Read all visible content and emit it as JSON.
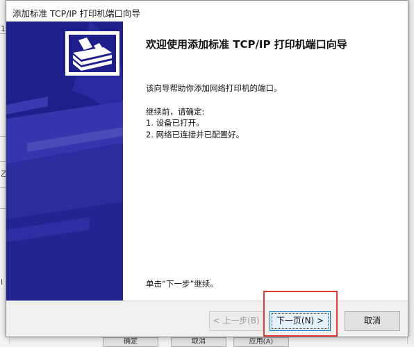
{
  "window_title": "添加标准 TCP/IP 打印机端口向导",
  "heading": "欢迎使用添加标准 TCP/IP 打印机端口向导",
  "intro": "该向导帮助你添加网络打印机的端口。",
  "before_label": "继续前，请确定:",
  "checklist": [
    "1.  设备已打开。",
    "2.  网络已连接并已配置好。"
  ],
  "footer_hint": "单击“下一步”继续。",
  "buttons": {
    "back": "< 上一步(B)",
    "next": "下一页(N) >",
    "cancel": "取消"
  },
  "background": {
    "left_glyphs": [
      "1",
      "乙",
      "I"
    ],
    "bottom_buttons": [
      "确定",
      "取消",
      "应用(A)"
    ]
  },
  "colors": {
    "side_panel": "#1f1f8c",
    "highlight": "#e03a3a",
    "focus": "#0078d7"
  },
  "icons": [
    "printer-logo-icon",
    "printer-illustration"
  ]
}
